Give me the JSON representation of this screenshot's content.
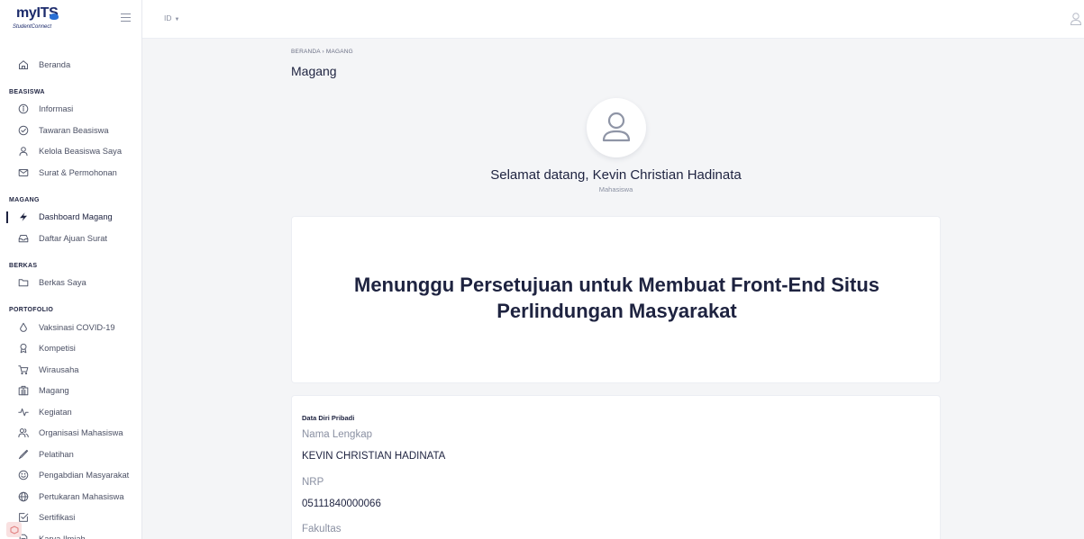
{
  "brand": {
    "logo_text": "myITS",
    "logo_sub": "StudentConnect"
  },
  "topbar": {
    "language": "ID"
  },
  "sidebar": {
    "top_item": {
      "label": "Beranda",
      "icon": "home-icon"
    },
    "sections": [
      {
        "title": "BEASISWA",
        "items": [
          {
            "label": "Informasi",
            "icon": "info-icon"
          },
          {
            "label": "Tawaran Beasiswa",
            "icon": "check-badge-icon"
          },
          {
            "label": "Kelola Beasiswa Saya",
            "icon": "user-icon"
          },
          {
            "label": "Surat & Permohonan",
            "icon": "mail-icon"
          }
        ]
      },
      {
        "title": "MAGANG",
        "items": [
          {
            "label": "Dashboard Magang",
            "icon": "lightning-icon",
            "active": true
          },
          {
            "label": "Daftar Ajuan Surat",
            "icon": "inbox-icon"
          }
        ]
      },
      {
        "title": "BERKAS",
        "items": [
          {
            "label": "Berkas Saya",
            "icon": "folder-icon"
          }
        ]
      },
      {
        "title": "PORTOFOLIO",
        "items": [
          {
            "label": "Vaksinasi COVID-19",
            "icon": "drop-icon"
          },
          {
            "label": "Kompetisi",
            "icon": "award-icon"
          },
          {
            "label": "Wirausaha",
            "icon": "cart-icon"
          },
          {
            "label": "Magang",
            "icon": "building-icon"
          },
          {
            "label": "Kegiatan",
            "icon": "activity-icon"
          },
          {
            "label": "Organisasi Mahasiswa",
            "icon": "users-icon"
          },
          {
            "label": "Pelatihan",
            "icon": "pen-icon"
          },
          {
            "label": "Pengabdian Masyarakat",
            "icon": "smile-icon"
          },
          {
            "label": "Pertukaran Mahasiswa",
            "icon": "globe-icon"
          },
          {
            "label": "Sertifikasi",
            "icon": "certificate-icon"
          },
          {
            "label": "Karya Ilmiah",
            "icon": "document-icon"
          }
        ]
      }
    ]
  },
  "main": {
    "breadcrumb": "BERANDA  ›  MAGANG",
    "title": "Magang",
    "welcome": "Selamat datang, Kevin Christian Hadinata",
    "role": "Mahasiswa",
    "status_title": "Menunggu Persetujuan untuk Membuat Front-End Situs Perlindungan Masyarakat",
    "personal": {
      "section_title": "Data Diri Pribadi",
      "fields": [
        {
          "label": "Nama Lengkap",
          "value": "KEVIN CHRISTIAN HADINATA"
        },
        {
          "label": "NRP",
          "value": "05111840000066"
        },
        {
          "label": "Fakultas",
          "value": ""
        }
      ]
    }
  }
}
